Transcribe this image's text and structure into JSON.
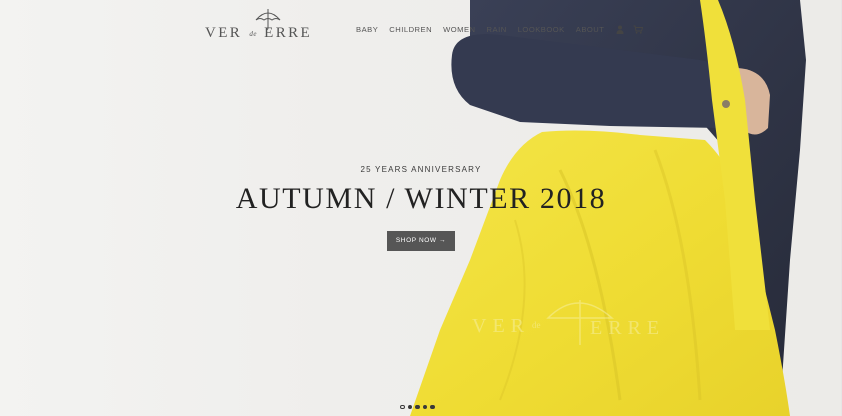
{
  "brand": {
    "logo_text_left": "VER",
    "logo_text_de": "de",
    "logo_text_right": "ERRE",
    "logo_icon": "umbrella-icon"
  },
  "nav": {
    "items": [
      "BABY",
      "CHILDREN",
      "WOMEN",
      "RAIN",
      "LOOKBOOK",
      "ABOUT"
    ],
    "account_icon": "user-icon",
    "cart_icon": "cart-icon"
  },
  "hero": {
    "eyebrow": "25 YEARS ANNIVERSARY",
    "headline": "AUTUMN / WINTER 2018",
    "cta_label": "SHOP NOW →",
    "bag_logo_left": "VER",
    "bag_logo_de": "de",
    "bag_logo_right": "ERRE"
  },
  "slider": {
    "slide_count": 5,
    "active_index": 0
  },
  "colors": {
    "bag_yellow": "#f2e23a",
    "jacket_navy": "#2f3446",
    "button_grey": "#565656",
    "text_dark": "#222222"
  }
}
